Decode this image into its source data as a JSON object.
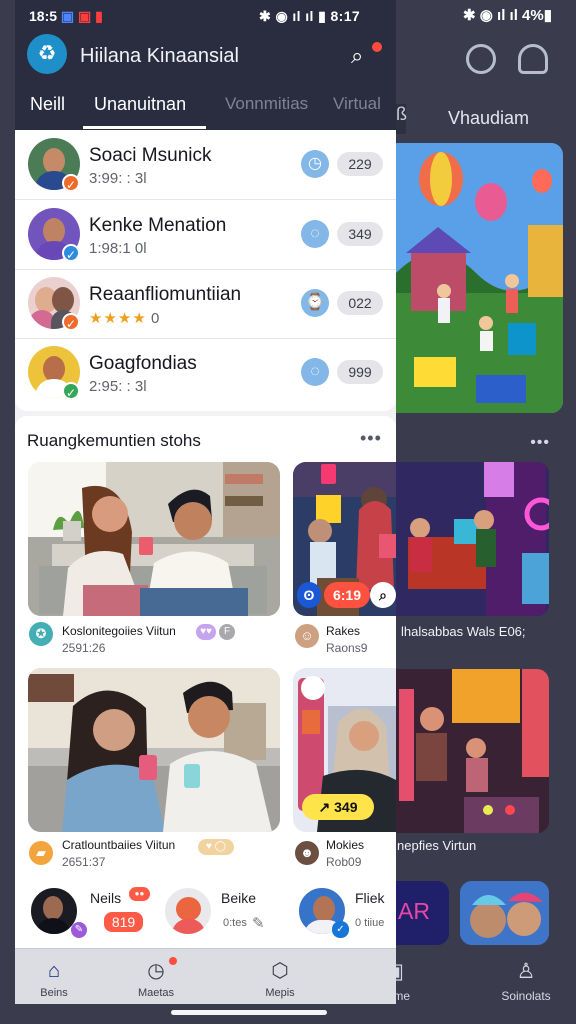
{
  "status_bar": {
    "time_left": "18:5",
    "right_text": "ıl ıl ▮ 8:17",
    "background_right_text": "ıl ıl 4%▮"
  },
  "header": {
    "app_title": "Hiilana Kinaansial",
    "tabs": [
      {
        "label": "Neill",
        "state": "inactive"
      },
      {
        "label": "Unanuitnan",
        "state": "active"
      },
      {
        "label": "Vonnmitias",
        "state": "muted"
      },
      {
        "label": "Virtual",
        "state": "muted"
      }
    ]
  },
  "contacts": [
    {
      "name": "Soaci Msunick",
      "subtitle": "3:99: : 3l",
      "count": "229",
      "badge_color": "#f06b2b",
      "icon": "timer-icon"
    },
    {
      "name": "Kenke Menation",
      "subtitle": "1:98:1 0l",
      "count": "349",
      "badge_color": "#2d8cdd",
      "icon": "shield-icon"
    },
    {
      "name": "Reaanfliomuntiian",
      "subtitle": "0",
      "rating": "★★★★",
      "count": "022",
      "badge_color": "#f06b2b",
      "icon": "clock-icon"
    },
    {
      "name": "Goagfondias",
      "subtitle": "2:95: : 3l",
      "count": "999",
      "badge_color": "#33a856",
      "icon": "verified-icon"
    }
  ],
  "feed": {
    "title": "Ruangkemuntien stohs",
    "more_label": "•••",
    "cards": [
      {
        "title": "Koslonitegoiies Viitun",
        "subtitle": "2591:26",
        "tag": "♥♥",
        "tag_color": "#c7a0ee"
      },
      {
        "title": "Rakes",
        "subtitle": "Raons9"
      },
      {
        "title": "Cratlountbaiies Viitun",
        "subtitle": "2651:37",
        "tag": "♥ ◯",
        "tag_color": "#f1d19a"
      },
      {
        "title": "Mokies",
        "subtitle": "Rob09"
      }
    ],
    "overlay_small": "8:19",
    "overlay_main": "6:19",
    "overlay_bottom": "349"
  },
  "stories": [
    {
      "name": "Neils",
      "value": "819",
      "sub": ""
    },
    {
      "name": "Beike",
      "value": "0:tes",
      "sub": ""
    },
    {
      "name": "Fliek",
      "value": "0 tiiue",
      "sub": ""
    }
  ],
  "nav": {
    "items": [
      {
        "label": "Beins"
      },
      {
        "label": "Maetas"
      },
      {
        "label": "Mepis"
      }
    ]
  },
  "background": {
    "tab": "Vhaudiam",
    "text_1": "lhalsabbas Wals E06;",
    "text_2": "nepfies Virtun",
    "nav_left": "Rome",
    "nav_right": "Soinolats"
  }
}
